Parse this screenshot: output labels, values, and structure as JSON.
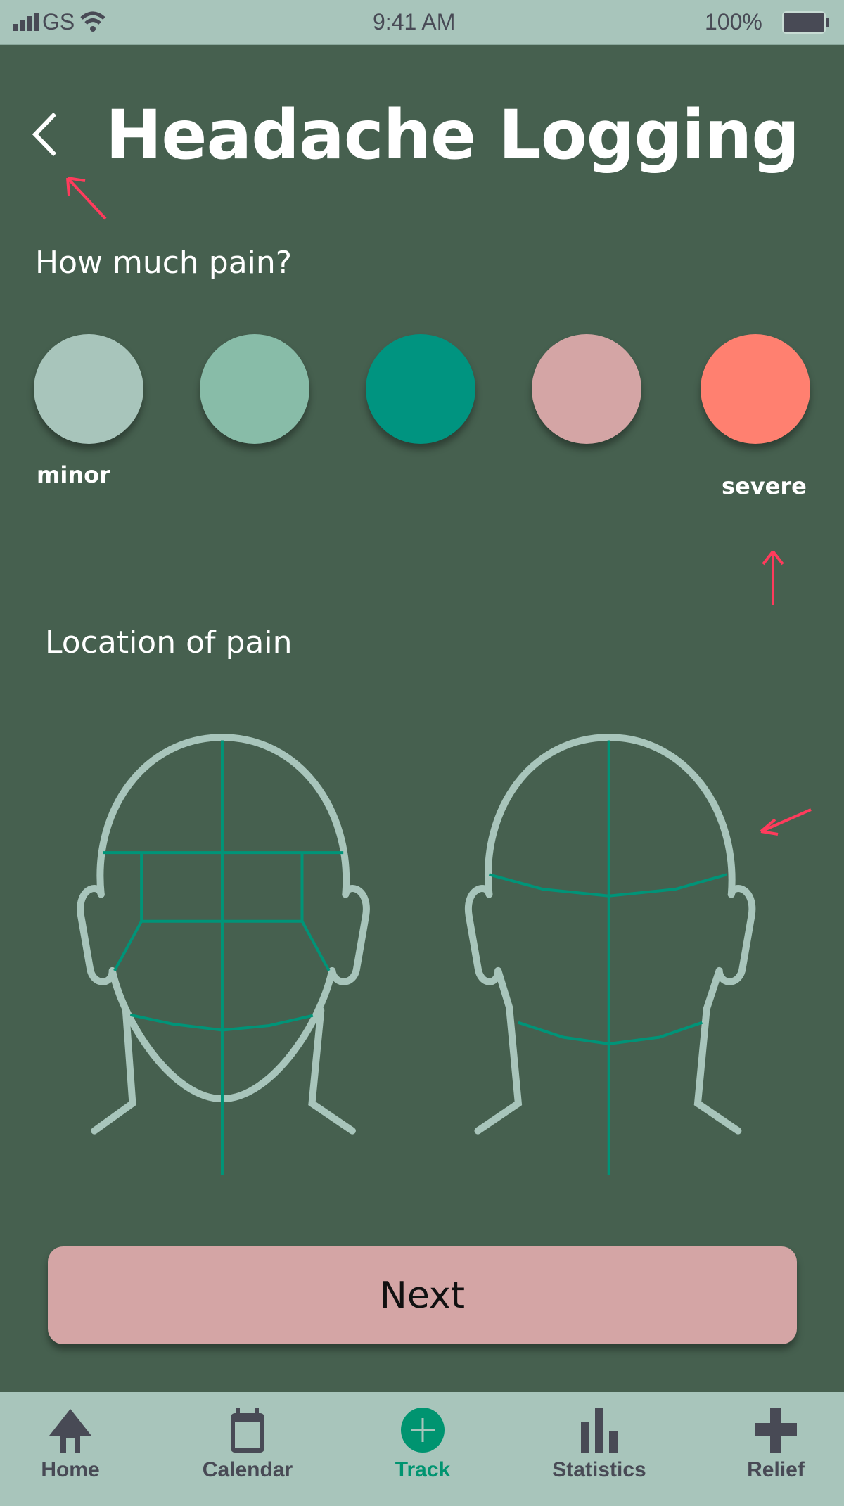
{
  "status_bar": {
    "carrier": "GS",
    "time": "9:41 AM",
    "battery": "100%"
  },
  "header": {
    "title": "Headache Logging",
    "back_icon": "chevron-left-icon"
  },
  "pain": {
    "question": "How much pain?",
    "levels": [
      {
        "level": 1,
        "color": "#a8c5bb"
      },
      {
        "level": 2,
        "color": "#88bca8"
      },
      {
        "level": 3,
        "color": "#009480"
      },
      {
        "level": 4,
        "color": "#d4a5a5"
      },
      {
        "level": 5,
        "color": "#ff8070"
      }
    ],
    "min_label": "minor",
    "max_label": "severe"
  },
  "location": {
    "label": "Location of pain",
    "views": [
      "front-head",
      "back-head"
    ]
  },
  "next_button": "Next",
  "nav": {
    "items": [
      {
        "label": "Home",
        "icon": "home-icon"
      },
      {
        "label": "Calendar",
        "icon": "calendar-icon"
      },
      {
        "label": "Track",
        "icon": "plus-circle-icon",
        "active": true
      },
      {
        "label": "Statistics",
        "icon": "bar-chart-icon"
      },
      {
        "label": "Relief",
        "icon": "cross-icon"
      }
    ]
  },
  "colors": {
    "background": "#46604f",
    "bar": "#a8c5bb",
    "accent": "#009470",
    "annotation": "#ff3b5c"
  }
}
